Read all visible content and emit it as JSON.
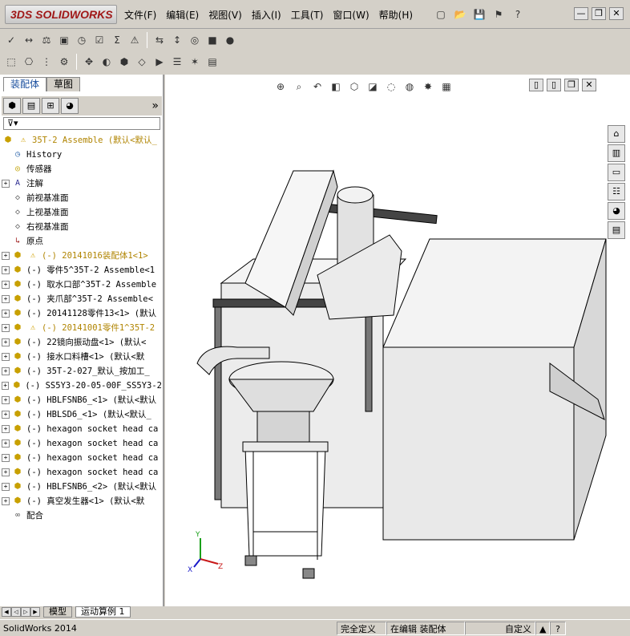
{
  "app": {
    "brand": "SOLIDWORKS",
    "brand_prefix": "3DS"
  },
  "menu": [
    "文件(F)",
    "编辑(E)",
    "视图(V)",
    "插入(I)",
    "工具(T)",
    "窗口(W)",
    "帮助(H)"
  ],
  "window_buttons": {
    "minimize": "—",
    "restore": "❐",
    "close": "✕"
  },
  "panel_tabs": [
    {
      "label": "装配体",
      "active": true
    },
    {
      "label": "草图",
      "active": false
    }
  ],
  "panel_collapse_label": "»",
  "tree": {
    "root": "35T-2 Assemble  (默认<默认_",
    "items": [
      {
        "label": "History",
        "icon": "history-icon",
        "expand": false
      },
      {
        "label": "传感器",
        "icon": "sensor-icon",
        "expand": false
      },
      {
        "label": "注解",
        "icon": "annotation-icon",
        "expand": true
      },
      {
        "label": "前视基准面",
        "icon": "plane-icon",
        "expand": false
      },
      {
        "label": "上视基准面",
        "icon": "plane-icon",
        "expand": false
      },
      {
        "label": "右视基准面",
        "icon": "plane-icon",
        "expand": false
      },
      {
        "label": "原点",
        "icon": "origin-icon",
        "expand": false
      },
      {
        "label": "(-) 20141016装配体1<1>",
        "icon": "subassembly-icon",
        "expand": true,
        "warn": true
      },
      {
        "label": "(-) 零件5^35T-2 Assemble<1",
        "icon": "subassembly-icon",
        "expand": true
      },
      {
        "label": "(-) 取水口部^35T-2 Assemble",
        "icon": "subassembly-icon",
        "expand": true
      },
      {
        "label": "(-) 夹爪部^35T-2 Assemble<",
        "icon": "subassembly-icon",
        "expand": true
      },
      {
        "label": "(-) 20141128零件13<1> (默认",
        "icon": "subassembly-icon",
        "expand": true
      },
      {
        "label": "(-) 20141001零件1^35T-2",
        "icon": "subassembly-icon",
        "expand": true,
        "warn": true
      },
      {
        "label": "(-) 22镜向振动盘<1> (默认<",
        "icon": "subassembly-icon",
        "expand": true
      },
      {
        "label": "(-) 接水口料槽<1> (默认<默",
        "icon": "subassembly-icon",
        "expand": true
      },
      {
        "label": "(-) 35T-2-027_默认_按加工_",
        "icon": "subassembly-icon",
        "expand": true
      },
      {
        "label": "(-) SS5Y3-20-05-00F_SS5Y3-2",
        "icon": "subassembly-icon",
        "expand": true
      },
      {
        "label": "(-) HBLFSNB6_<1> (默认<默认",
        "icon": "subassembly-icon",
        "expand": true
      },
      {
        "label": "(-) HBLSD6_<1> (默认<默认_",
        "icon": "subassembly-icon",
        "expand": true
      },
      {
        "label": "(-) hexagon socket head ca",
        "icon": "subassembly-icon",
        "expand": true
      },
      {
        "label": "(-) hexagon socket head ca",
        "icon": "subassembly-icon",
        "expand": true
      },
      {
        "label": "(-) hexagon socket head ca",
        "icon": "subassembly-icon",
        "expand": true
      },
      {
        "label": "(-) hexagon socket head ca",
        "icon": "subassembly-icon",
        "expand": true
      },
      {
        "label": "(-) HBLFSNB6_<2> (默认<默认",
        "icon": "subassembly-icon",
        "expand": true
      },
      {
        "label": "(-) 真空发生器<1> (默认<默",
        "icon": "subassembly-icon",
        "expand": true
      },
      {
        "label": "配合",
        "icon": "mates-icon",
        "expand": false
      }
    ]
  },
  "bottom_tabs": [
    {
      "label": "模型",
      "active": true
    },
    {
      "label": "运动算例 1",
      "active": false
    }
  ],
  "status": {
    "app": "SolidWorks 2014",
    "definition": "完全定义",
    "editing": "在编辑 装配体",
    "units": "自定义",
    "up_arrow": "▲",
    "help": "?"
  },
  "triad": {
    "x": "X",
    "y": "Y",
    "z": "Z"
  },
  "colors": {
    "accent": "#316ac5",
    "warn": "#b08400",
    "model_line": "#000000"
  }
}
